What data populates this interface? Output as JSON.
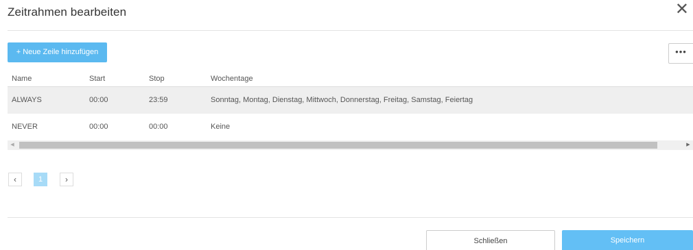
{
  "dialog": {
    "title": "Zeitrahmen bearbeiten",
    "close_glyph": "✕"
  },
  "toolbar": {
    "add_row_label": "+ Neue Zeile hinzufügen",
    "more_label": "•••"
  },
  "table": {
    "columns": [
      "Name",
      "Start",
      "Stop",
      "Wochentage"
    ],
    "rows": [
      {
        "name": "ALWAYS",
        "start": "00:00",
        "stop": "23:59",
        "days": "Sonntag, Montag, Dienstag, Mittwoch, Donnerstag, Freitag, Samstag, Feiertag"
      },
      {
        "name": "NEVER",
        "start": "00:00",
        "stop": "00:00",
        "days": "Keine"
      }
    ]
  },
  "scrollbar": {
    "left_arrow": "◀",
    "right_arrow": "▶"
  },
  "pagination": {
    "prev": "‹",
    "current_page": "1",
    "next": "›"
  },
  "footer": {
    "close_label": "Schließen",
    "save_label": "Speichern"
  },
  "colors": {
    "primary": "#5bb9f0",
    "row_highlight": "#efefef"
  }
}
